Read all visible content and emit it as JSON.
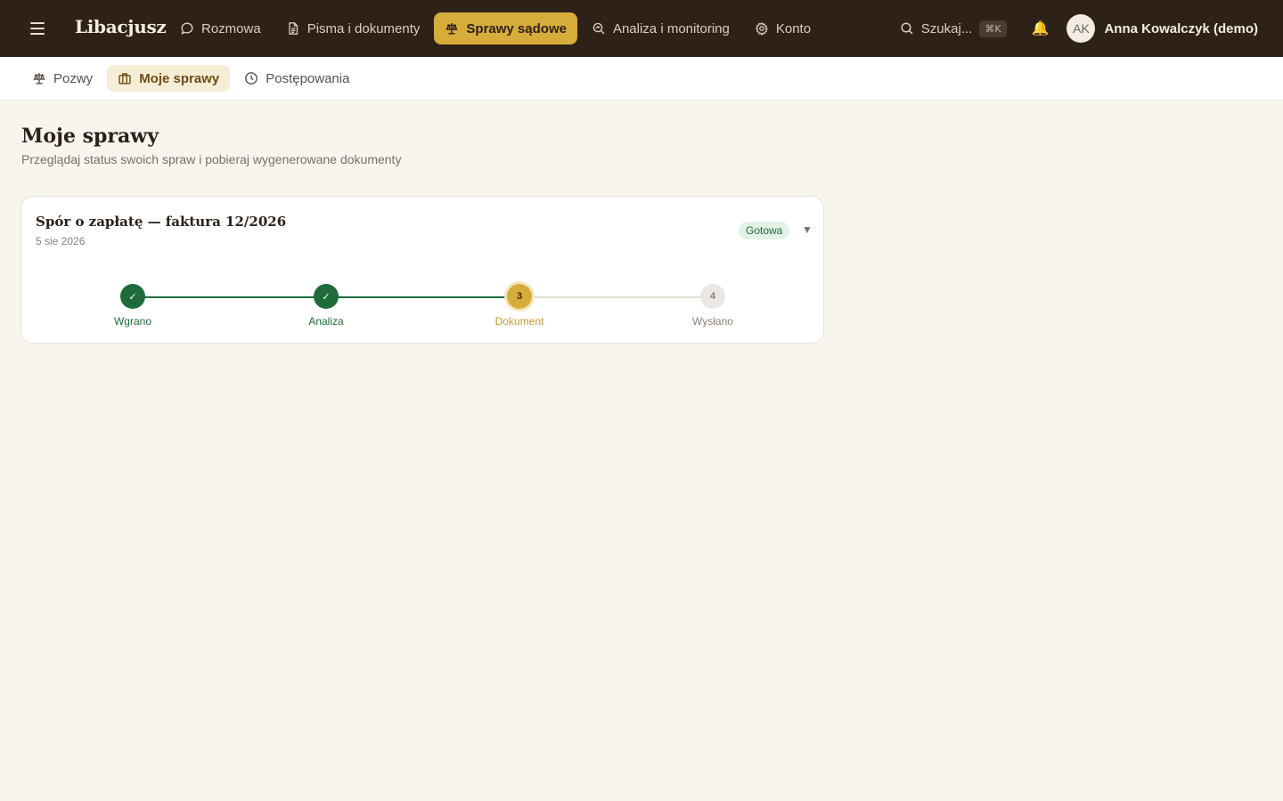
{
  "app": {
    "logo": "Libacjusz"
  },
  "nav": {
    "items": [
      {
        "label": "Rozmowa",
        "icon": "chat-bubble-icon"
      },
      {
        "label": "Pisma i dokumenty",
        "icon": "document-icon"
      },
      {
        "label": "Sprawy sądowe",
        "icon": "scales-icon",
        "active": true
      },
      {
        "label": "Analiza i monitoring",
        "icon": "search-analysis-icon"
      },
      {
        "label": "Konto",
        "icon": "gear-icon"
      }
    ]
  },
  "search": {
    "label": "Szukaj...",
    "shortcut": "⌘K"
  },
  "user": {
    "initials": "AK",
    "name": "Anna Kowalczyk (demo)"
  },
  "subnav": {
    "items": [
      {
        "label": "Pozwy",
        "icon": "scales-icon"
      },
      {
        "label": "Moje sprawy",
        "icon": "briefcase-icon",
        "active": true
      },
      {
        "label": "Postępowania",
        "icon": "clock-icon"
      }
    ]
  },
  "page": {
    "title": "Moje sprawy",
    "subtitle": "Przeglądaj status swoich spraw i pobieraj wygenerowane dokumenty"
  },
  "cases": [
    {
      "title": "Spór o zapłatę — faktura 12/2026",
      "date": "5 sie 2026",
      "status": "Gotowa",
      "steps": [
        {
          "label": "Wgrano",
          "marker": "✓",
          "state": "done"
        },
        {
          "label": "Analiza",
          "marker": "✓",
          "state": "done"
        },
        {
          "label": "Dokument",
          "marker": "3",
          "state": "current"
        },
        {
          "label": "Wysłano",
          "marker": "4",
          "state": "todo"
        }
      ]
    }
  ],
  "colors": {
    "topbar": "#2e2117",
    "accent": "#d6ad3a",
    "success": "#1f6b3a",
    "background": "#f8f5ee"
  }
}
